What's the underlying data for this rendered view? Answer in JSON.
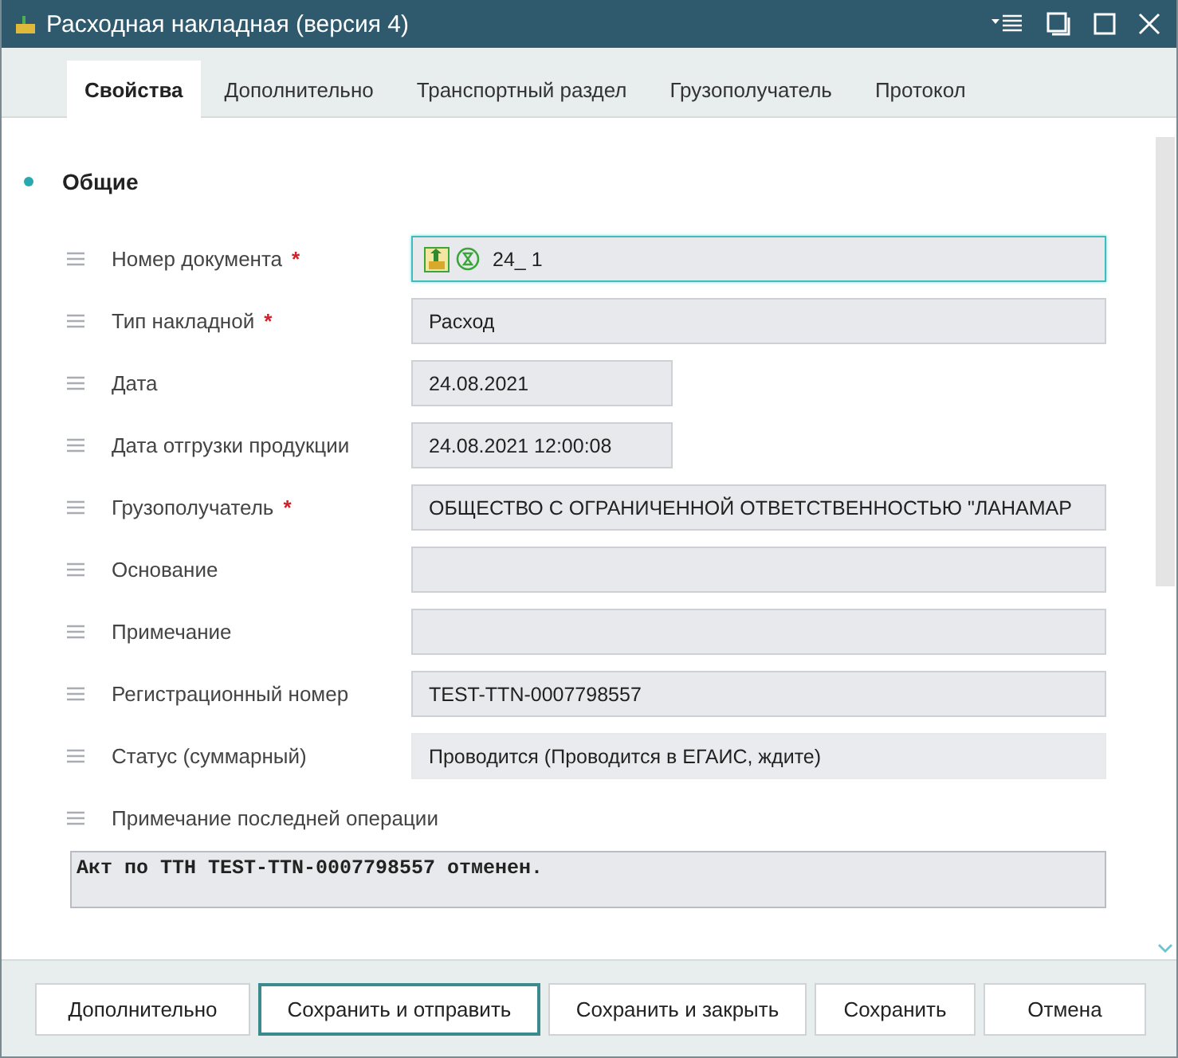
{
  "window": {
    "title": "Расходная накладная (версия 4)"
  },
  "tabs": [
    {
      "label": "Свойства",
      "selected": true
    },
    {
      "label": "Дополнительно",
      "selected": false
    },
    {
      "label": "Транспортный раздел",
      "selected": false
    },
    {
      "label": "Грузополучатель",
      "selected": false
    },
    {
      "label": "Протокол",
      "selected": false
    }
  ],
  "section": {
    "title": "Общие"
  },
  "fields": [
    {
      "kind": "document-number",
      "label": "Номер документа",
      "required": true,
      "value": "24_ 1",
      "focused": true
    },
    {
      "kind": "wide",
      "label": "Тип накладной",
      "required": true,
      "value": "Расход",
      "focused": false
    },
    {
      "kind": "short",
      "label": "Дата",
      "required": false,
      "value": "24.08.2021",
      "focused": false
    },
    {
      "kind": "short",
      "label": "Дата отгрузки продукции",
      "required": false,
      "value": "24.08.2021 12:00:08",
      "focused": false
    },
    {
      "kind": "wide",
      "label": "Грузополучатель",
      "required": true,
      "value": "ОБЩЕСТВО С ОГРАНИЧЕННОЙ ОТВЕТСТВЕННОСТЬЮ \"ЛАНАМАР",
      "focused": false
    },
    {
      "kind": "wide",
      "label": "Основание",
      "required": false,
      "focused": false
    },
    {
      "kind": "wide",
      "label": "Примечание",
      "required": false,
      "focused": false
    },
    {
      "kind": "wide",
      "label": "Регистрационный номер",
      "required": false,
      "value": "TEST-TTN-0007798557",
      "focused": false
    },
    {
      "kind": "status",
      "label": "Статус (суммарный)",
      "required": false,
      "value": "Проводится (Проводится в ЕГАИС, ждите)",
      "focused": false
    },
    {
      "kind": "memo",
      "label": "Примечание последней операции",
      "required": false,
      "value": "Акт по ТТН TEST-TTN-0007798557 отменен.",
      "focused": false
    }
  ],
  "required_mark": "*",
  "buttons": [
    {
      "label": "Дополнительно",
      "focused": false
    },
    {
      "label": "Сохранить и отправить",
      "focused": true
    },
    {
      "label": "Сохранить и закрыть",
      "focused": false
    },
    {
      "label": "Сохранить",
      "focused": false
    },
    {
      "label": "Отмена",
      "focused": false
    }
  ]
}
